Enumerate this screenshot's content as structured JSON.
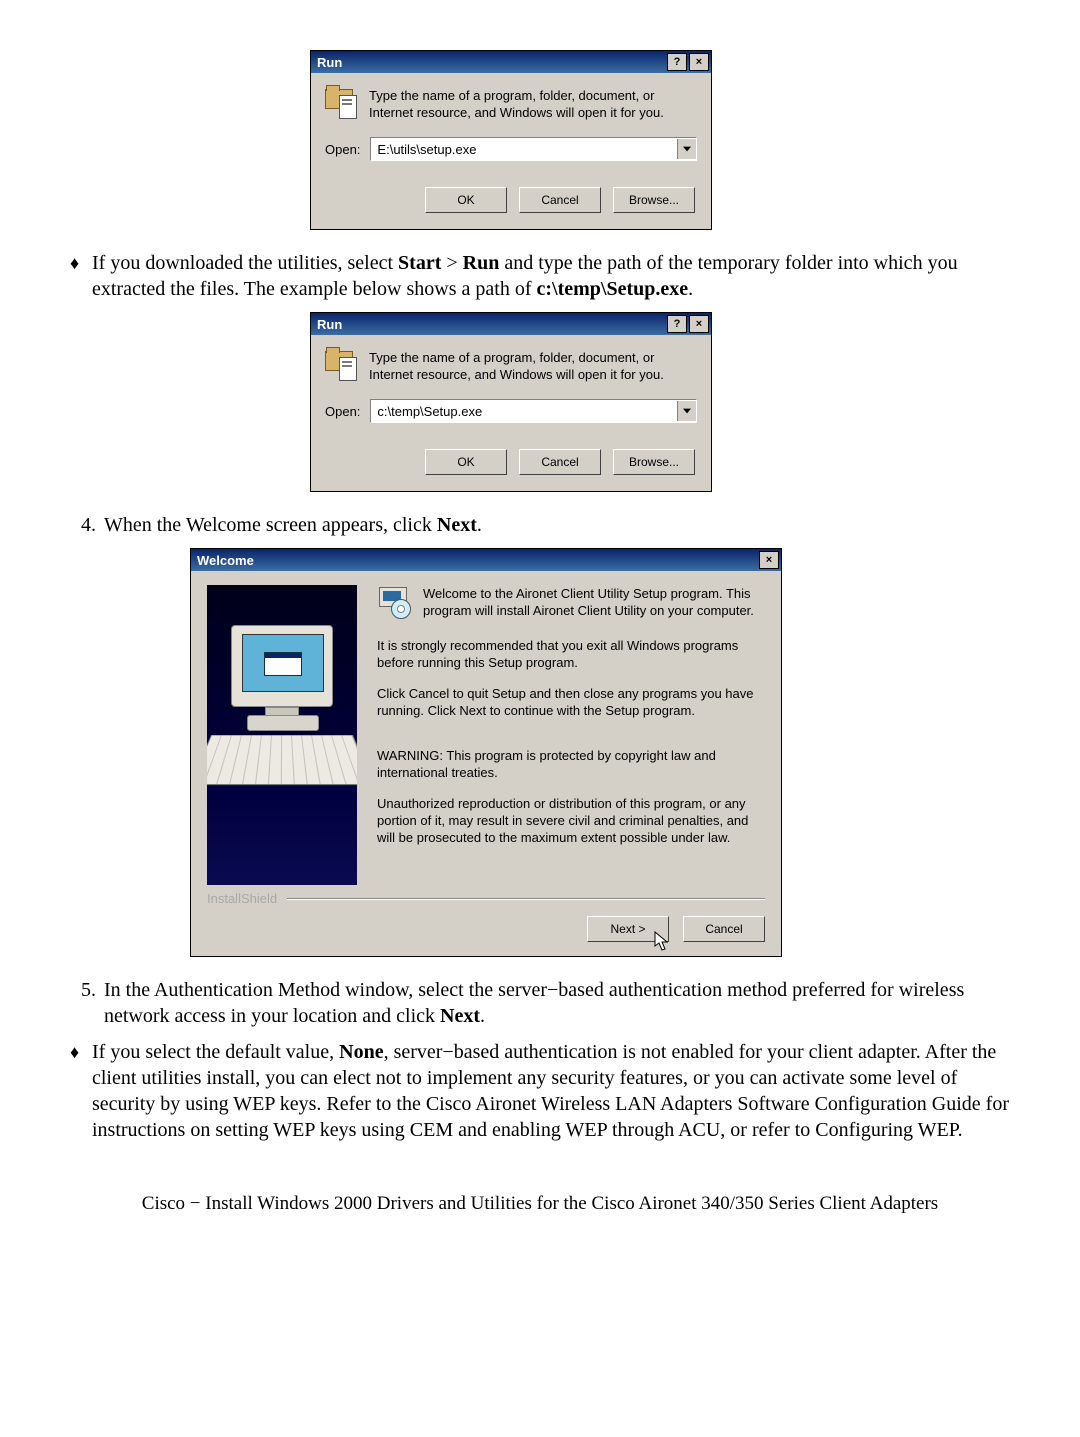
{
  "run1": {
    "title": "Run",
    "help_icon_label": "?",
    "close_icon_label": "×",
    "message": "Type the name of a program, folder, document, or Internet resource, and Windows will open it for you.",
    "open_label": "Open:",
    "value": "E:\\utils\\setup.exe",
    "ok": "OK",
    "cancel": "Cancel",
    "browse": "Browse..."
  },
  "bullet1_a": "If you downloaded the utilities, select ",
  "bullet1_b": "Start",
  "bullet1_c": " > ",
  "bullet1_d": "Run",
  "bullet1_e": " and type the path of the temporary folder into which you extracted the files. The example below shows a path of ",
  "bullet1_f": "c:\\temp\\Setup.exe",
  "bullet1_g": ".",
  "run2": {
    "title": "Run",
    "message": "Type the name of a program, folder, document, or Internet resource, and Windows will open it for you.",
    "open_label": "Open:",
    "value": "c:\\temp\\Setup.exe",
    "ok": "OK",
    "cancel": "Cancel",
    "browse": "Browse..."
  },
  "step4_num": "4.",
  "step4_a": "When the Welcome screen appears, click ",
  "step4_b": "Next",
  "step4_c": ".",
  "welcome": {
    "title": "Welcome",
    "close_icon_label": "×",
    "hdr": "Welcome to the Aironet Client Utility Setup program. This program will install Aironet Client Utility on your computer.",
    "p1": "It is strongly recommended that you exit all Windows programs before running this Setup program.",
    "p2": "Click Cancel to quit Setup and then close any programs you have running.  Click Next to continue with the Setup program.",
    "p3": "WARNING: This program is protected by copyright law and international treaties.",
    "p4": "Unauthorized reproduction or distribution of this program, or any portion of it, may result in severe civil and criminal penalties, and will be prosecuted to the maximum extent possible under law.",
    "brand": "InstallShield",
    "next": "Next >",
    "cancel": "Cancel"
  },
  "step5_num": "5.",
  "step5_a": "In the Authentication Method window, select the server−based authentication method preferred for wireless network access in your location and click ",
  "step5_b": "Next",
  "step5_c": ".",
  "bullet2_a": "If you select the default value, ",
  "bullet2_b": "None",
  "bullet2_c": ", server−based authentication is not enabled for your client adapter. After the client utilities install, you can elect not to implement any security features, or you can activate some level of security by using WEP keys. Refer to the Cisco Aironet Wireless LAN Adapters Software Configuration Guide for instructions on setting WEP keys using CEM and enabling WEP through ACU, or refer to Configuring WEP.",
  "footer": "Cisco − Install Windows 2000 Drivers and Utilities for the Cisco Aironet 340/350 Series Client Adapters"
}
